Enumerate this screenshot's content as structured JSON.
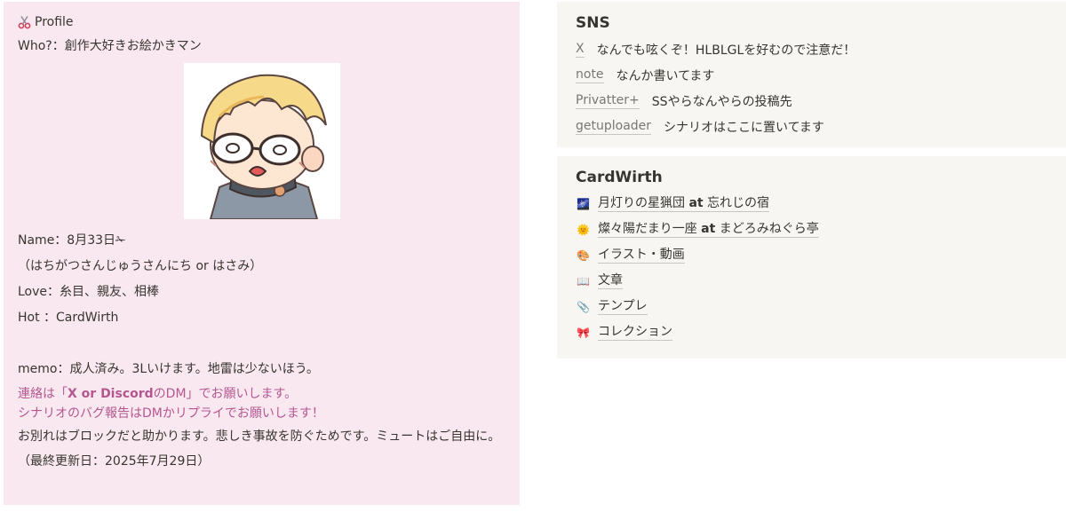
{
  "profile": {
    "title_icon": "scissors-icon",
    "title": "Profile",
    "who": "Who?：創作大好きお絵かきマン",
    "name": "Name：8月33日✁",
    "reading": "（はちがつさんじゅうさんにち or はさみ）",
    "love": "Love：糸目、親友、相棒",
    "hot": "Hot ：CardWirth",
    "memo": "memo：成人済み。3Lいけます。地雷は少ないほう。",
    "contact_before": "連絡は「",
    "contact_bold": "X or Discord",
    "contact_after": "のDM」でお願いします。",
    "bug_report": "シナリオのバグ報告はDMかリプライでお願いします！",
    "farewell": "お別れはブロックだと助かります。悲しき事故を防ぐためです。ミュートはご自由に。",
    "updated": "（最終更新日：2025年7月29日）",
    "colors": {
      "background": "#f9e8f0",
      "accent_pink": "#b4578f"
    }
  },
  "sns": {
    "heading": "SNS",
    "items": [
      {
        "link": "X",
        "desc": "なんでも呟くぞ！HLBLGLを好むので注意だ！"
      },
      {
        "link": "note",
        "desc": "なんか書いてます"
      },
      {
        "link": "Privatter+",
        "desc": "SSやらなんやらの投稿先"
      },
      {
        "link": "getuploader",
        "desc": "シナリオはここに置いてます"
      }
    ]
  },
  "cardwirth": {
    "heading": "CardWirth",
    "items": [
      {
        "icon": "night-sky-icon",
        "glyph": "🌌",
        "pre": "月灯りの星猟団 ",
        "bold": "at",
        "post": " 忘れじの宿"
      },
      {
        "icon": "sun-face-icon",
        "glyph": "🌞",
        "pre": "燦々陽だまり一座 ",
        "bold": "at",
        "post": " まどろみねぐら亭"
      },
      {
        "icon": "palette-icon",
        "glyph": "🎨",
        "pre": "イラスト・動画",
        "bold": "",
        "post": ""
      },
      {
        "icon": "open-book-icon",
        "glyph": "📖",
        "pre": "文章",
        "bold": "",
        "post": ""
      },
      {
        "icon": "paperclip-icon",
        "glyph": "📎",
        "pre": "テンプレ",
        "bold": "",
        "post": ""
      },
      {
        "icon": "ribbon-icon",
        "glyph": "🎀",
        "pre": "コレクション",
        "bold": "",
        "post": ""
      }
    ]
  }
}
